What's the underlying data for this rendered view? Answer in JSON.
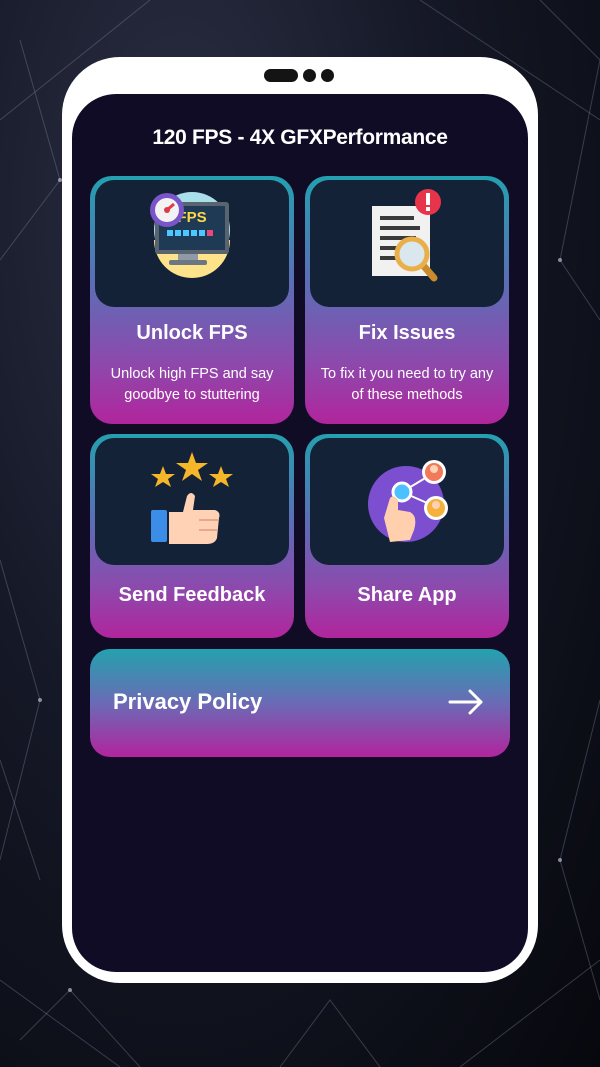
{
  "app": {
    "title": "120 FPS - 4X GFXPerformance"
  },
  "cards": [
    {
      "label": "Unlock FPS",
      "description": "Unlock high FPS and say goodbye to stuttering",
      "icon": "fps-monitor-icon",
      "fps_text": "FPS"
    },
    {
      "label": "Fix Issues",
      "description": "To fix it you need to try any of these methods",
      "icon": "document-warning-icon"
    },
    {
      "label": "Send Feedback",
      "icon": "thumbs-up-stars-icon"
    },
    {
      "label": "Share App",
      "icon": "share-network-icon"
    }
  ],
  "privacy": {
    "label": "Privacy Policy",
    "icon": "arrow-right-icon"
  },
  "colors": {
    "screen_bg": "#100c26",
    "card_top": "#24a0b0",
    "card_bottom": "#b1259c",
    "image_box": "#142238"
  }
}
